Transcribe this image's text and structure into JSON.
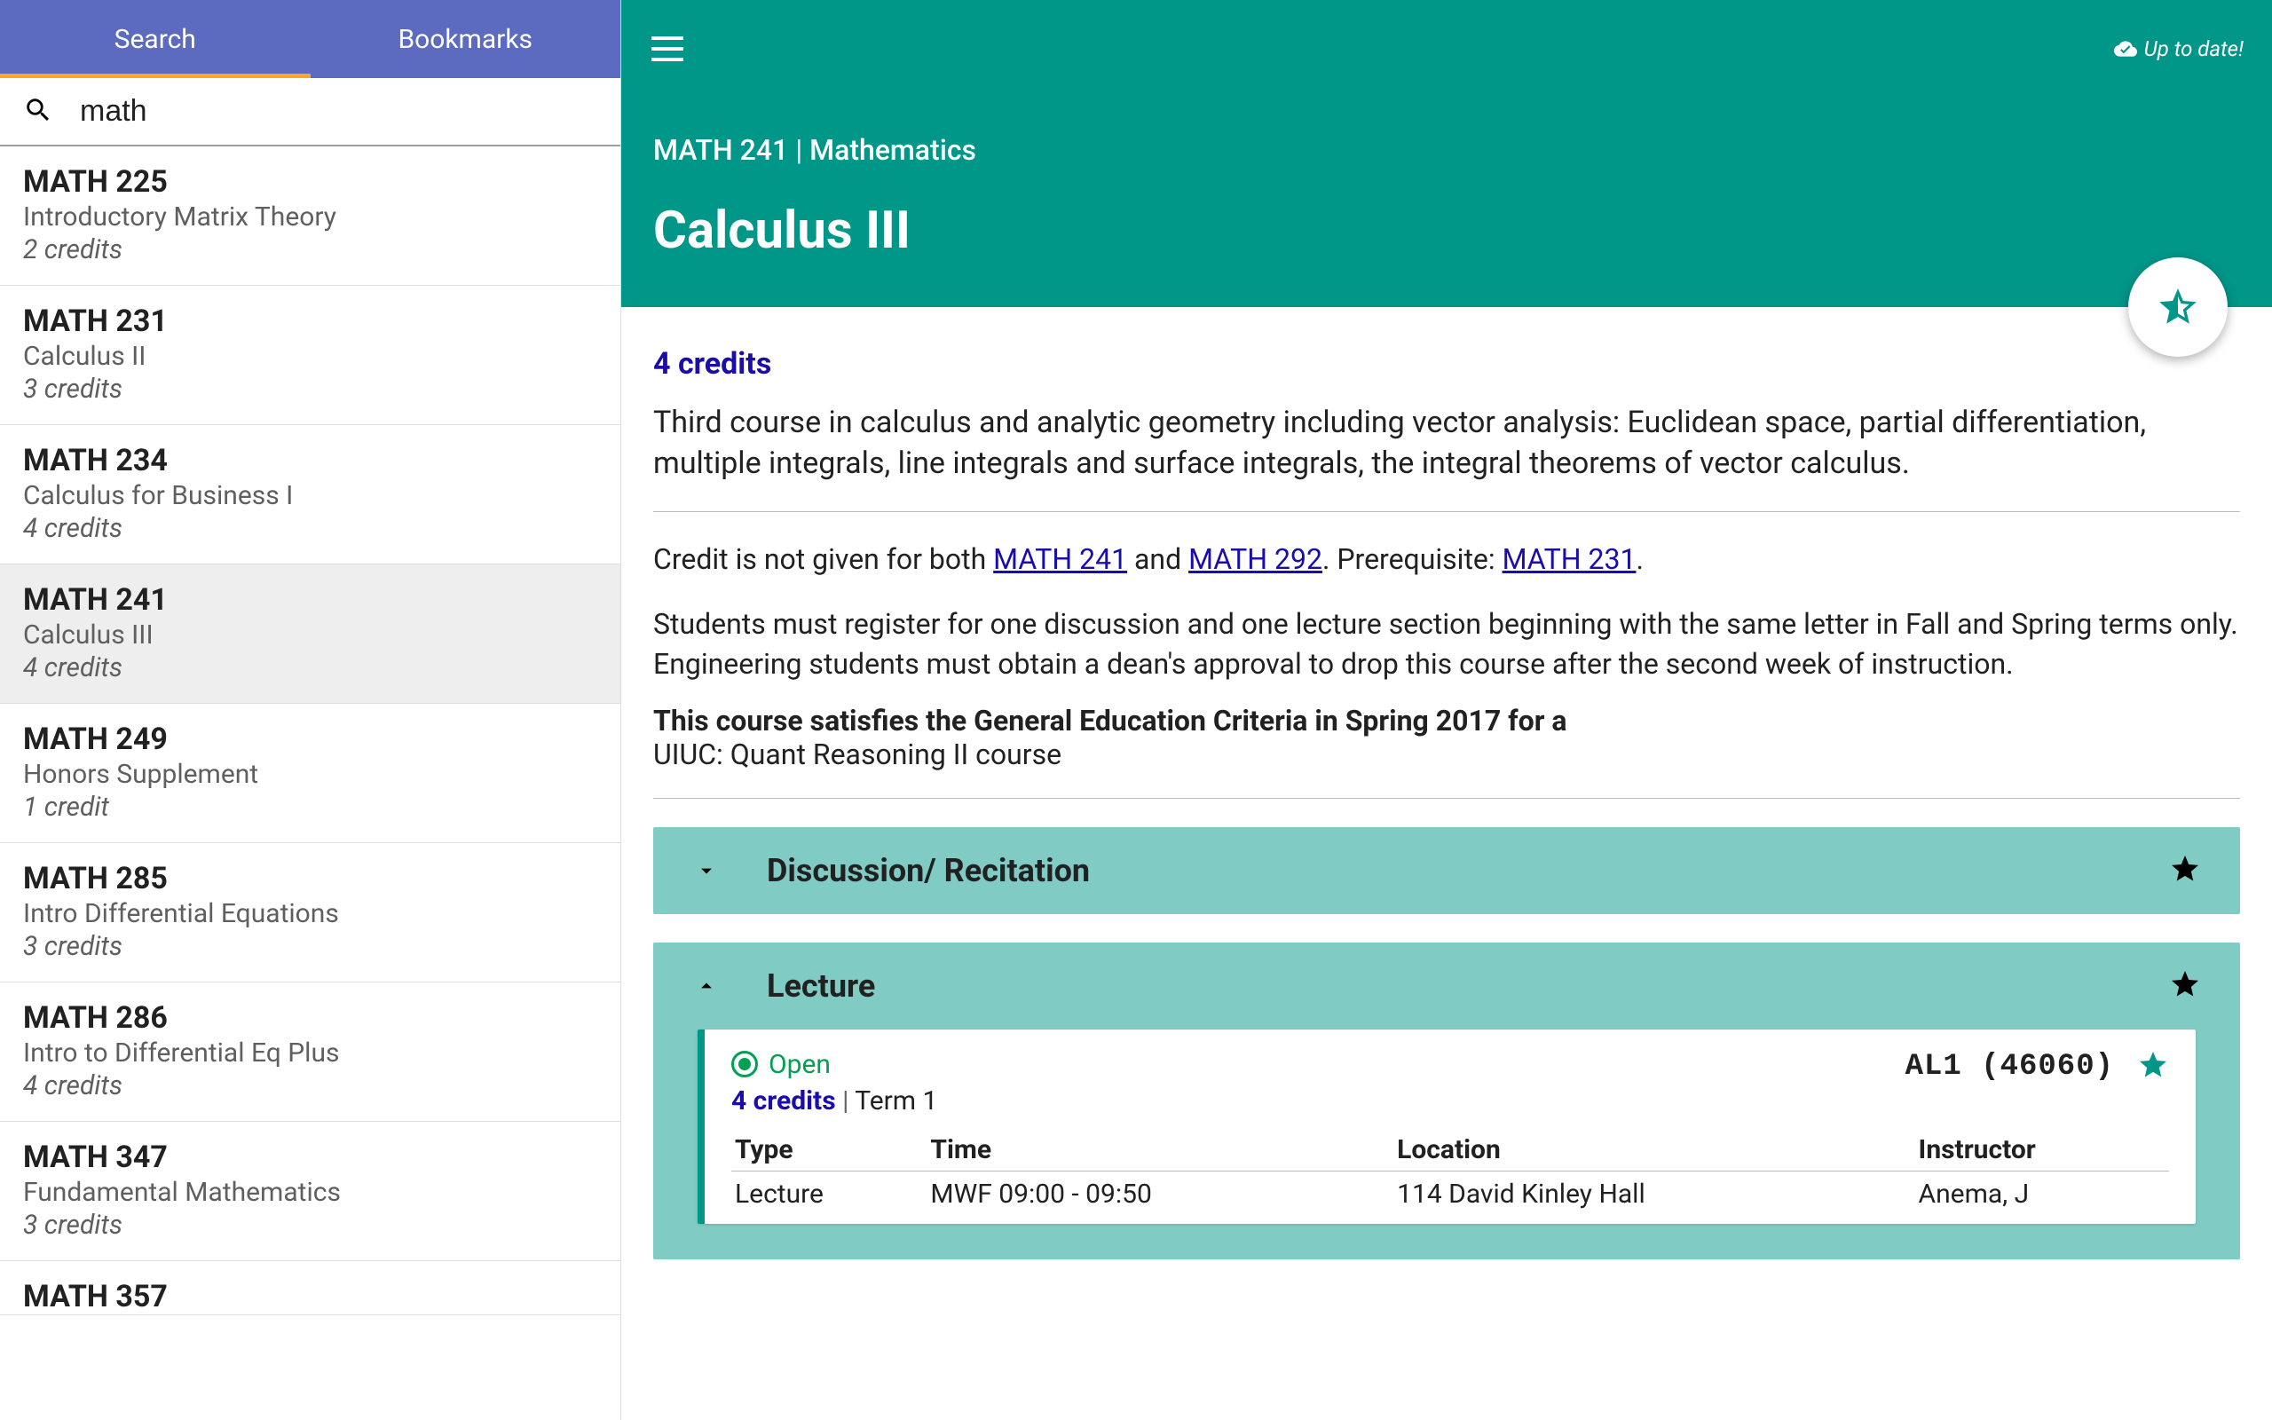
{
  "sidebar": {
    "tabs": {
      "search": "Search",
      "bookmarks": "Bookmarks"
    },
    "search_value": "math",
    "results": [
      {
        "code": "MATH 225",
        "title": "Introductory Matrix Theory",
        "credits": "2 credits",
        "selected": false
      },
      {
        "code": "MATH 231",
        "title": "Calculus II",
        "credits": "3 credits",
        "selected": false
      },
      {
        "code": "MATH 234",
        "title": "Calculus for Business I",
        "credits": "4 credits",
        "selected": false
      },
      {
        "code": "MATH 241",
        "title": "Calculus III",
        "credits": "4 credits",
        "selected": true
      },
      {
        "code": "MATH 249",
        "title": "Honors Supplement",
        "credits": "1 credit",
        "selected": false
      },
      {
        "code": "MATH 285",
        "title": "Intro Differential Equations",
        "credits": "3 credits",
        "selected": false
      },
      {
        "code": "MATH 286",
        "title": "Intro to Differential Eq Plus",
        "credits": "4 credits",
        "selected": false
      },
      {
        "code": "MATH 347",
        "title": "Fundamental Mathematics",
        "credits": "3 credits",
        "selected": false
      }
    ],
    "peek_code": "MATH 357"
  },
  "header": {
    "uptodate": "Up to date!",
    "breadcrumb": "MATH 241 | Mathematics",
    "course_title": "Calculus III"
  },
  "detail": {
    "credits": "4 credits",
    "description": "Third course in calculus and analytic geometry including vector analysis: Euclidean space, partial differentiation, multiple integrals, line integrals and surface integrals, the integral theorems of vector calculus.",
    "prereq_prefix": "Credit is not given for both ",
    "link1": "MATH 241",
    "prereq_mid": " and ",
    "link2": "MATH 292",
    "prereq_after": ". Prerequisite: ",
    "link3": "MATH 231",
    "prereq_end": ".",
    "note": "Students must register for one discussion and one lecture section beginning with the same letter in Fall and Spring terms only. Engineering students must obtain a dean's approval to drop this course after the second week of instruction.",
    "gened_bold": "This course satisfies the General Education Criteria in Spring 2017 for a",
    "gened_line": "UIUC: Quant Reasoning II course"
  },
  "sections": {
    "discussion_label": "Discussion/ Recitation",
    "lecture_label": "Lecture"
  },
  "offering": {
    "status": "Open",
    "crn": "AL1 (46060)",
    "credits": "4 credits",
    "term": "Term 1",
    "columns": {
      "type": "Type",
      "time": "Time",
      "location": "Location",
      "instructor": "Instructor"
    },
    "row": {
      "type": "Lecture",
      "time": "MWF 09:00 - 09:50",
      "location": "114 David Kinley Hall",
      "instructor": "Anema, J"
    }
  }
}
